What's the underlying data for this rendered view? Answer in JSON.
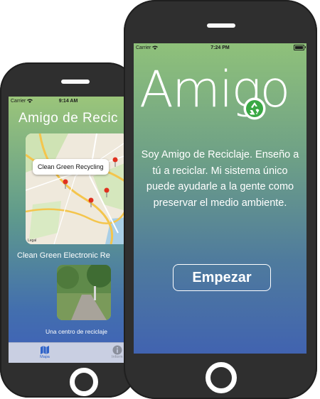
{
  "back_phone": {
    "status": {
      "carrier": "Carrier",
      "time": "9:14 AM"
    },
    "title": "Amigo de Recic",
    "map": {
      "callout": "Clean Green Recycling",
      "legal": "Legal",
      "pin_color": "#e0301e"
    },
    "place": {
      "name": "Clean Green Electronic Re",
      "caption": "Una centro de reciclaje"
    },
    "tabs": [
      {
        "label": "Mapa",
        "icon": "map-icon",
        "selected": true
      },
      {
        "label": "Inform",
        "icon": "info-icon",
        "selected": false
      }
    ]
  },
  "front_phone": {
    "status": {
      "carrier": "Carrier",
      "time": "7:24 PM"
    },
    "logo": {
      "before_o": "Amig",
      "after": ""
    },
    "description": "Soy Amigo de Reciclaje. Enseño a tú a reciclar. Mi sistema único puede ayudarle a la gente como preservar el medio ambiente.",
    "start_button": "Empezar"
  },
  "colors": {
    "frame": "#2f2f2f",
    "accent_green": "#3aa845",
    "tab_selected": "#2f63c9"
  }
}
